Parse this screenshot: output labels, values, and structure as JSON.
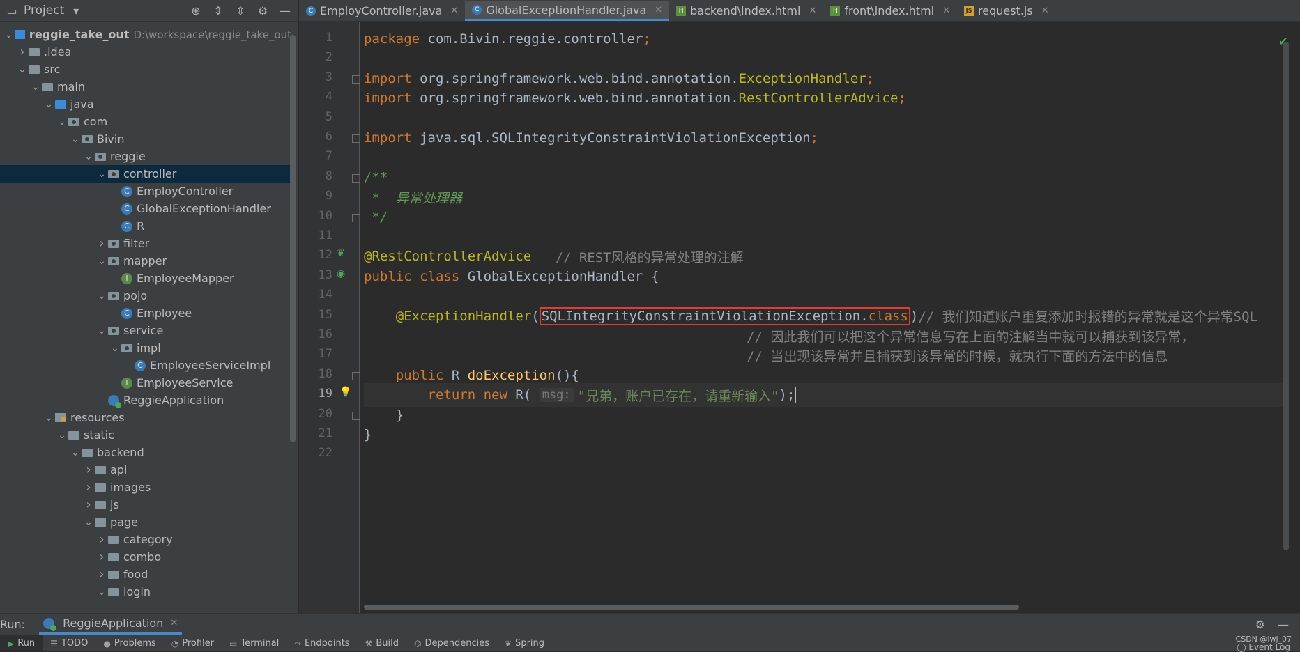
{
  "sidebar": {
    "title": "Project",
    "tree": [
      {
        "label": "reggie_take_out",
        "path": "D:\\workspace\\reggie_take_out",
        "depth": 0,
        "kind": "module",
        "open": true,
        "bold": true
      },
      {
        "label": ".idea",
        "depth": 1,
        "kind": "folder",
        "open": false
      },
      {
        "label": "src",
        "depth": 1,
        "kind": "folder",
        "open": true
      },
      {
        "label": "main",
        "depth": 2,
        "kind": "folder",
        "open": true
      },
      {
        "label": "java",
        "depth": 3,
        "kind": "folder-blue",
        "open": true
      },
      {
        "label": "com",
        "depth": 4,
        "kind": "package",
        "open": true
      },
      {
        "label": "Bivin",
        "depth": 5,
        "kind": "package",
        "open": true
      },
      {
        "label": "reggie",
        "depth": 6,
        "kind": "package",
        "open": true
      },
      {
        "label": "controller",
        "depth": 7,
        "kind": "package",
        "open": true,
        "selected": true
      },
      {
        "label": "EmployController",
        "depth": 8,
        "kind": "class"
      },
      {
        "label": "GlobalExceptionHandler",
        "depth": 8,
        "kind": "class"
      },
      {
        "label": "R",
        "depth": 8,
        "kind": "class"
      },
      {
        "label": "filter",
        "depth": 7,
        "kind": "package",
        "open": false
      },
      {
        "label": "mapper",
        "depth": 7,
        "kind": "package",
        "open": true
      },
      {
        "label": "EmployeeMapper",
        "depth": 8,
        "kind": "interface"
      },
      {
        "label": "pojo",
        "depth": 7,
        "kind": "package",
        "open": true
      },
      {
        "label": "Employee",
        "depth": 8,
        "kind": "class"
      },
      {
        "label": "service",
        "depth": 7,
        "kind": "package",
        "open": true
      },
      {
        "label": "impl",
        "depth": 8,
        "kind": "package",
        "open": true
      },
      {
        "label": "EmployeeServiceImpl",
        "depth": 9,
        "kind": "class"
      },
      {
        "label": "EmployeeService",
        "depth": 8,
        "kind": "interface"
      },
      {
        "label": "ReggieApplication",
        "depth": 7,
        "kind": "app"
      },
      {
        "label": "resources",
        "depth": 3,
        "kind": "resources",
        "open": true
      },
      {
        "label": "static",
        "depth": 4,
        "kind": "folder",
        "open": true
      },
      {
        "label": "backend",
        "depth": 5,
        "kind": "folder",
        "open": true
      },
      {
        "label": "api",
        "depth": 6,
        "kind": "folder",
        "open": false
      },
      {
        "label": "images",
        "depth": 6,
        "kind": "folder",
        "open": false
      },
      {
        "label": "js",
        "depth": 6,
        "kind": "folder",
        "open": false
      },
      {
        "label": "page",
        "depth": 6,
        "kind": "folder",
        "open": true
      },
      {
        "label": "category",
        "depth": 7,
        "kind": "folder",
        "open": false
      },
      {
        "label": "combo",
        "depth": 7,
        "kind": "folder",
        "open": false
      },
      {
        "label": "food",
        "depth": 7,
        "kind": "folder",
        "open": false
      },
      {
        "label": "login",
        "depth": 7,
        "kind": "folder",
        "open": true
      }
    ]
  },
  "tabs": [
    {
      "label": "EmployController.java",
      "icon": "class",
      "active": false
    },
    {
      "label": "GlobalExceptionHandler.java",
      "icon": "class",
      "active": true
    },
    {
      "label": "backend\\index.html",
      "icon": "html",
      "active": false
    },
    {
      "label": "front\\index.html",
      "icon": "html",
      "active": false
    },
    {
      "label": "request.js",
      "icon": "js",
      "active": false
    }
  ],
  "editor": {
    "current_line": 19,
    "lines": [
      [
        [
          "kw",
          "package "
        ],
        [
          "",
          "com.Bivin.reggie.controller"
        ],
        [
          "kw",
          ";"
        ]
      ],
      [],
      [
        [
          "kw",
          "import "
        ],
        [
          "",
          "org.springframework.web.bind.annotation."
        ],
        [
          "ann",
          "ExceptionHandler"
        ],
        [
          "kw",
          ";"
        ]
      ],
      [
        [
          "kw",
          "import "
        ],
        [
          "",
          "org.springframework.web.bind.annotation."
        ],
        [
          "ann",
          "RestControllerAdvice"
        ],
        [
          "kw",
          ";"
        ]
      ],
      [],
      [
        [
          "kw",
          "import "
        ],
        [
          "",
          "java.sql.SQLIntegrityConstraintViolationException"
        ],
        [
          "kw",
          ";"
        ]
      ],
      [],
      [
        [
          "doc",
          "/**"
        ]
      ],
      [
        [
          "doc",
          " *  异常处理器"
        ]
      ],
      [
        [
          "doc",
          " */"
        ]
      ],
      [],
      [
        [
          "ann",
          "@RestControllerAdvice"
        ],
        [
          "cm",
          "   // REST风格的异常处理的注解"
        ]
      ],
      [
        [
          "kw",
          "public class "
        ],
        [
          "",
          "GlobalExceptionHandler {"
        ]
      ],
      [],
      [
        [
          "",
          "    "
        ],
        [
          "ann",
          "@ExceptionHandler"
        ],
        [
          "",
          "("
        ],
        [
          "box",
          "SQLIntegrityConstraintViolationException.|class"
        ],
        [
          "",
          ")"
        ],
        [
          "cm",
          "// 我们知道账户重复添加时报错的异常就是这个异常SQL"
        ]
      ],
      [
        [
          "cm",
          "                                                // 因此我们可以把这个异常信息写在上面的注解当中就可以捕获到该异常，"
        ]
      ],
      [
        [
          "cm",
          "                                                // 当出现该异常并且捕获到该异常的时候，就执行下面的方法中的信息"
        ]
      ],
      [
        [
          "",
          "    "
        ],
        [
          "kw",
          "public "
        ],
        [
          "",
          "R "
        ],
        [
          "fn",
          "doException"
        ],
        [
          "",
          "(){"
        ]
      ],
      [
        [
          "",
          "        "
        ],
        [
          "kw",
          "return new "
        ],
        [
          "",
          "R( "
        ],
        [
          "hint",
          "msg:"
        ],
        [
          "str",
          "\"兄弟，账户已存在，请重新输入\""
        ],
        [
          "",
          ");"
        ],
        [
          "caret",
          ""
        ]
      ],
      [
        [
          "",
          "    }"
        ]
      ],
      [
        [
          "",
          "}"
        ]
      ],
      []
    ]
  },
  "runbar": {
    "label": "Run:",
    "app": "ReggieApplication"
  },
  "bottombar": {
    "items": [
      "Run",
      "TODO",
      "Problems",
      "Profiler",
      "Terminal",
      "Endpoints",
      "Build",
      "Dependencies",
      "Spring"
    ],
    "watermark": "CSDN @lwj_07",
    "event_log": "Event Log"
  }
}
